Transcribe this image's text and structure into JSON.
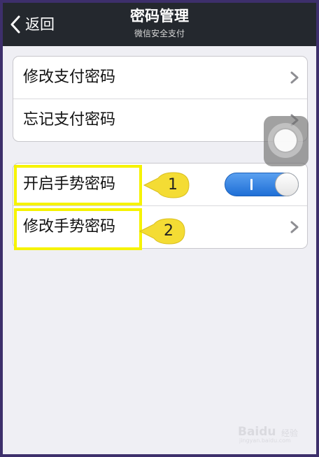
{
  "navbar": {
    "back_label": "返回",
    "title": "密码管理",
    "subtitle": "微信安全支付"
  },
  "groups": [
    {
      "items": [
        {
          "label": "修改支付密码",
          "accessory": "chevron-right-icon"
        },
        {
          "label": "忘记支付密码",
          "accessory": "chevron-right-icon"
        }
      ]
    },
    {
      "items": [
        {
          "label": "开启手势密码",
          "accessory": "toggle",
          "toggle_on": true
        },
        {
          "label": "修改手势密码",
          "accessory": "chevron-right-icon"
        }
      ]
    }
  ],
  "annotations": [
    {
      "number": "1"
    },
    {
      "number": "2"
    }
  ],
  "watermark": {
    "brand": "Baidu",
    "suffix": "经验",
    "url": "jingyan.baidu.com"
  },
  "colors": {
    "navbar_bg": "#24282e",
    "page_bg": "#efeff4",
    "frame_border": "#3d2f6b",
    "toggle_on": "#1f6fd6",
    "highlight": "#f6f300",
    "callout": "#f4dc34"
  }
}
